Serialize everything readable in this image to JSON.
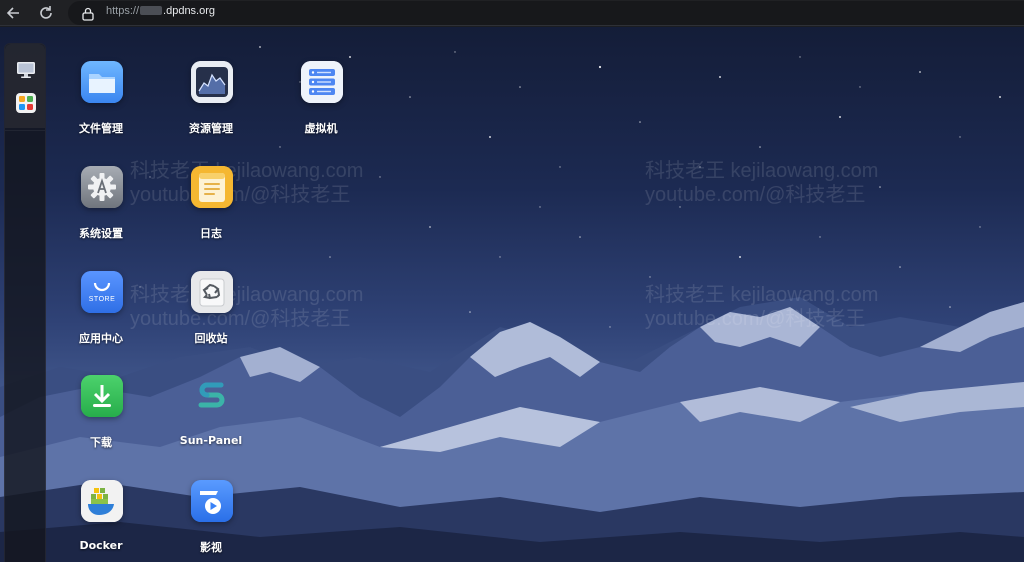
{
  "browser": {
    "url_scheme": "https://",
    "url_host": ".dpdns.org"
  },
  "watermark": {
    "line1": "科技老王 kejilaowang.com",
    "line2": "youtube.com/@科技老王"
  },
  "dock": {
    "items": [
      {
        "name": "desktop",
        "icon": "monitor-icon"
      },
      {
        "name": "apps",
        "icon": "app-grid-icon"
      }
    ]
  },
  "apps": [
    {
      "id": "file-manager",
      "label": "文件管理",
      "icon": "folder-icon",
      "color": "#4a9ef5"
    },
    {
      "id": "resource-manager",
      "label": "资源管理",
      "icon": "chart-icon",
      "color": "#2b3550"
    },
    {
      "id": "virtual-machine",
      "label": "虚拟机",
      "icon": "server-icon",
      "color": "#eef3fb"
    },
    {
      "id": "system-settings",
      "label": "系统设置",
      "icon": "gear-icon",
      "color": "#8e939b"
    },
    {
      "id": "log",
      "label": "日志",
      "icon": "notepad-icon",
      "color": "#f5b731"
    },
    {
      "id": "app-center",
      "label": "应用中心",
      "icon": "store-icon",
      "color": "#3d7ef0",
      "badge": "STORE"
    },
    {
      "id": "recycle-bin",
      "label": "回收站",
      "icon": "recycle-icon",
      "color": "#e7e8ea"
    },
    {
      "id": "download",
      "label": "下载",
      "icon": "download-icon",
      "color": "#35c45a"
    },
    {
      "id": "sun-panel",
      "label": "Sun-Panel",
      "icon": "sun-panel-icon",
      "color": "#3bb3a8"
    },
    {
      "id": "docker",
      "label": "Docker",
      "icon": "docker-icon",
      "color": "#f2f2f2"
    },
    {
      "id": "video",
      "label": "影视",
      "icon": "video-icon",
      "color": "#3a82f7"
    }
  ]
}
